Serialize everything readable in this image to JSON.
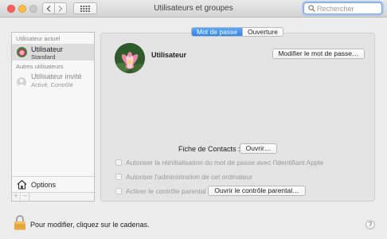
{
  "window": {
    "title": "Utilisateurs et groupes",
    "search_placeholder": "Rechercher"
  },
  "sidebar": {
    "current_section": "Utilisateur actuel",
    "current_user": {
      "name": "Utilisateur",
      "role": "Standard"
    },
    "other_section": "Autres utilisateurs",
    "guest_user": {
      "name": "Utilisateur invité",
      "state": "Activé, Contrôlé"
    },
    "options_label": "Options",
    "add_label": "+",
    "remove_label": "−"
  },
  "tabs": [
    {
      "label": "Mot de passe",
      "selected": true
    },
    {
      "label": "Ouverture",
      "selected": false
    }
  ],
  "main": {
    "user_name": "Utilisateur",
    "change_password_label": "Modifier le mot de passe…",
    "contact_card_label": "Fiche de Contacts :",
    "open_label": "Ouvrir…",
    "checkboxes": [
      {
        "label": "Autoriser la réinitialisation du mot de passe avec l'identifiant Apple",
        "checked": false,
        "enabled": false
      },
      {
        "label": "Autoriser l'administration de cet ordinateur",
        "checked": false,
        "enabled": false
      },
      {
        "label": "Activer le contrôle parental",
        "checked": false,
        "enabled": false
      }
    ],
    "parental_controls_label": "Ouvrir le contrôle parental…"
  },
  "footer": {
    "lock_text": "Pour modifier, cliquez sur le cadenas.",
    "help_label": "?"
  },
  "colors": {
    "accent": "#2d84ee",
    "close": "#fc605c",
    "minimize": "#fdbc40",
    "lock": "#e6a83d"
  }
}
